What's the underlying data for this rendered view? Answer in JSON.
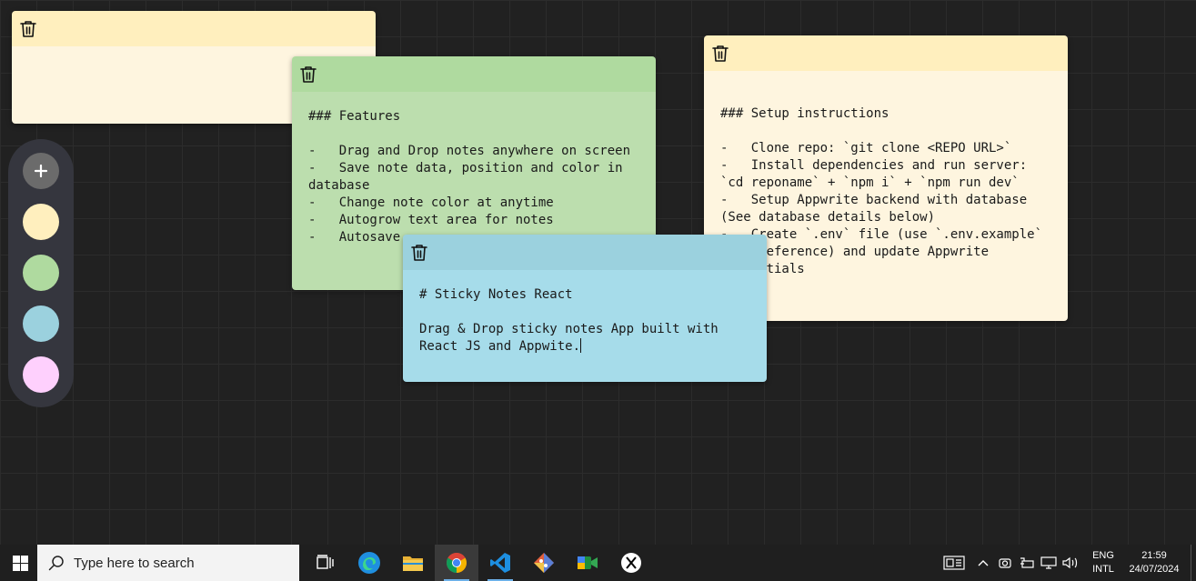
{
  "notes": [
    {
      "id": "note-a",
      "color_name": "yellow",
      "header_color": "#ffefbe",
      "body_color": "#fef5df",
      "text": ""
    },
    {
      "id": "note-b",
      "color_name": "green",
      "header_color": "#afda9f",
      "body_color": "#bcdeae",
      "text": "### Features\n\n-   Drag and Drop notes anywhere on screen\n-   Save note data, position and color in database\n-   Change note color at anytime\n-   Autogrow text area for notes\n-   Autosave"
    },
    {
      "id": "note-c",
      "color_name": "yellow",
      "header_color": "#ffefbe",
      "body_color": "#fef5df",
      "text": "### Setup instructions\n\n-   Clone repo: `git clone <REPO URL>`\n-   Install dependencies and run server: `cd reponame` + `npm i` + `npm run dev`\n-   Setup Appwrite backend with database (See database details below)\n-   Create `.env` file (use `.env.example` as a reference) and update Appwrite credentials"
    },
    {
      "id": "note-d",
      "color_name": "blue",
      "header_color": "#9bd1de",
      "body_color": "#a6dcea",
      "text": "# Sticky Notes React\n\nDrag & Drop sticky notes App built with React JS and Appwite."
    }
  ],
  "controls": {
    "add_icon": "plus-icon",
    "swatches": [
      {
        "name": "yellow",
        "color": "#ffefbe"
      },
      {
        "name": "green",
        "color": "#afda9f"
      },
      {
        "name": "blue",
        "color": "#9bd1de"
      },
      {
        "name": "purple",
        "color": "#fed0fd"
      }
    ]
  },
  "taskbar": {
    "search_placeholder": "Type here to search",
    "apps": [
      "task-view-icon",
      "edge-icon",
      "file-explorer-icon",
      "chrome-icon",
      "vscode-icon",
      "git-icon",
      "meet-icon",
      "x-icon"
    ],
    "lang_line1": "ENG",
    "lang_line2": "INTL",
    "time": "21:59",
    "date": "24/07/2024"
  }
}
